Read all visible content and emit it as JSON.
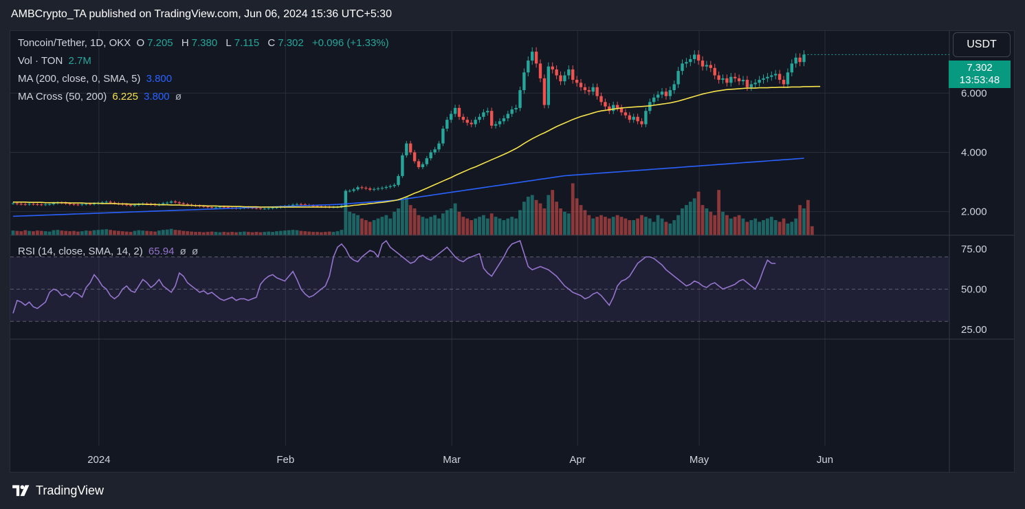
{
  "caption": "AMBCrypto_TA published on TradingView.com, Jun 06, 2024 15:36 UTC+5:30",
  "legend": {
    "symbol": "Toncoin/Tether, 1D, OKX",
    "o_label": "O",
    "o_value": "7.205",
    "h_label": "H",
    "h_value": "7.380",
    "l_label": "L",
    "l_value": "7.115",
    "c_label": "C",
    "c_value": "7.302",
    "change": "+0.096 (+1.33%)",
    "vol_label": "Vol · TON",
    "vol_value": "2.7M",
    "ma_label": "MA (200, close, 0, SMA, 5)",
    "ma_value": "3.800",
    "macross_label": "MA Cross (50, 200)",
    "macross_fast": "6.225",
    "macross_slow": "3.800",
    "macross_symbol": "ø",
    "rsi_label": "RSI (14, close, SMA, 14, 2)",
    "rsi_value": "65.94",
    "rsi_sym1": "ø",
    "rsi_sym2": "ø"
  },
  "currency_button": "USDT",
  "price_tag": {
    "price": "7.302",
    "countdown": "13:53:48"
  },
  "footer_brand": "TradingView",
  "colors": {
    "up": "#26a69a",
    "down": "#ef5350",
    "ma200": "#2962ff",
    "ma50": "#f7e34c",
    "rsi": "#9575cd",
    "background": "#131722",
    "grid": "#2a2e39",
    "text": "#d1d4dc"
  },
  "chart_data": {
    "type": "candlestick",
    "x_ticks": [
      "2024",
      "Feb",
      "Mar",
      "Apr",
      "May",
      "Jun"
    ],
    "price_axis": {
      "ticks": [
        "2.000",
        "4.000",
        "6.000"
      ],
      "range": [
        1.2,
        8.1
      ]
    },
    "rsi_axis": {
      "ticks": [
        "25.00",
        "50.00",
        "75.00"
      ],
      "range": [
        19,
        83
      ],
      "levels": [
        70,
        50,
        30
      ]
    },
    "close": [
      2.28,
      2.26,
      2.25,
      2.24,
      2.26,
      2.25,
      2.24,
      2.23,
      2.24,
      2.25,
      2.28,
      2.3,
      2.29,
      2.27,
      2.25,
      2.24,
      2.23,
      2.25,
      2.26,
      2.25,
      2.27,
      2.29,
      2.31,
      2.33,
      2.3,
      2.28,
      2.26,
      2.24,
      2.22,
      2.2,
      2.22,
      2.25,
      2.27,
      2.26,
      2.24,
      2.22,
      2.25,
      2.28,
      2.3,
      2.34,
      2.31,
      2.28,
      2.25,
      2.23,
      2.21,
      2.2,
      2.18,
      2.17,
      2.15,
      2.13,
      2.14,
      2.16,
      2.15,
      2.13,
      2.12,
      2.11,
      2.12,
      2.14,
      2.13,
      2.12,
      2.11,
      2.1,
      2.1,
      2.11,
      2.13,
      2.14,
      2.16,
      2.18,
      2.2,
      2.23,
      2.25,
      2.24,
      2.22,
      2.2,
      2.19,
      2.18,
      2.17,
      2.16,
      2.15,
      2.15,
      2.16,
      2.2,
      2.7,
      2.7,
      2.75,
      2.82,
      2.8,
      2.78,
      2.74,
      2.76,
      2.78,
      2.8,
      2.83,
      2.86,
      2.9,
      3.2,
      3.9,
      4.3,
      4.0,
      3.7,
      3.5,
      3.6,
      3.8,
      4.0,
      4.1,
      4.3,
      4.8,
      5.1,
      5.3,
      5.5,
      5.2,
      5.1,
      5.0,
      4.95,
      5.1,
      5.2,
      5.35,
      5.4,
      4.9,
      4.95,
      5.05,
      5.15,
      5.3,
      5.45,
      5.5,
      6.1,
      6.7,
      7.1,
      7.4,
      7.0,
      6.5,
      5.6,
      6.9,
      6.8,
      6.6,
      6.4,
      6.6,
      6.8,
      6.45,
      6.35,
      6.2,
      6.1,
      6.05,
      6.2,
      5.9,
      5.7,
      5.55,
      5.4,
      5.6,
      5.5,
      5.35,
      5.25,
      5.1,
      5.2,
      5.05,
      4.95,
      5.4,
      5.7,
      5.85,
      5.95,
      6.05,
      5.9,
      6.1,
      6.3,
      6.75,
      7.0,
      7.05,
      7.15,
      7.3,
      7.1,
      6.9,
      6.95,
      6.85,
      6.6,
      6.45,
      6.5,
      6.35,
      6.55,
      6.5,
      6.4,
      6.45,
      6.2,
      6.3,
      6.35,
      6.45,
      6.5,
      6.55,
      6.6,
      6.65,
      6.45,
      6.3,
      6.7,
      7.0,
      7.2,
      7.05,
      7.302
    ],
    "volume_millions": [
      1.4,
      1.3,
      1.2,
      1.5,
      1.3,
      1.2,
      1.4,
      1.3,
      1.2,
      1.1,
      1.5,
      1.6,
      1.4,
      1.3,
      1.2,
      1.3,
      1.1,
      1.2,
      1.4,
      1.3,
      1.5,
      1.6,
      1.7,
      1.8,
      1.6,
      1.4,
      1.3,
      1.2,
      1.1,
      1.0,
      1.3,
      1.5,
      1.4,
      1.3,
      1.2,
      1.1,
      1.4,
      1.6,
      1.7,
      1.9,
      1.6,
      1.5,
      1.3,
      1.2,
      1.1,
      1.0,
      1.0,
      0.9,
      1.0,
      1.1,
      1.0,
      0.9,
      1.0,
      0.9,
      1.0,
      0.9,
      1.0,
      1.1,
      1.0,
      0.9,
      1.0,
      0.9,
      1.0,
      1.1,
      1.0,
      1.2,
      1.3,
      1.4,
      1.5,
      1.6,
      1.5,
      1.3,
      1.2,
      1.1,
      1.0,
      1.0,
      0.9,
      1.0,
      1.1,
      1.0,
      1.2,
      1.6,
      9.0,
      7.0,
      6.5,
      6.0,
      5.0,
      4.5,
      4.0,
      4.5,
      5.0,
      5.5,
      6.0,
      5.0,
      7.0,
      8.0,
      10.5,
      11.5,
      9.0,
      8.0,
      6.0,
      5.5,
      5.0,
      5.5,
      6.0,
      5.0,
      6.5,
      7.5,
      8.0,
      9.5,
      7.0,
      5.5,
      5.0,
      4.5,
      5.0,
      5.5,
      6.0,
      5.0,
      6.5,
      5.5,
      5.0,
      4.5,
      5.0,
      5.5,
      5.0,
      7.5,
      10.0,
      11.5,
      12.0,
      10.5,
      9.5,
      8.0,
      12.0,
      13.5,
      10.0,
      8.0,
      7.0,
      6.5,
      15.5,
      11.0,
      9.0,
      7.5,
      6.0,
      5.0,
      5.5,
      6.0,
      5.5,
      5.0,
      5.5,
      6.0,
      5.5,
      5.0,
      4.5,
      4.5,
      5.0,
      6.0,
      5.5,
      5.0,
      4.0,
      6.0,
      5.0,
      4.0,
      3.5,
      4.5,
      6.0,
      8.0,
      9.0,
      10.0,
      11.0,
      13.0,
      9.0,
      8.0,
      7.0,
      6.0,
      13.5,
      7.0,
      6.0,
      5.0,
      5.5,
      6.0,
      5.0,
      4.0,
      4.5,
      5.0,
      4.0,
      4.5,
      5.0,
      5.5,
      4.5,
      4.0,
      5.0,
      3.5,
      4.0,
      5.0,
      9.0,
      8.0,
      10.5,
      2.7
    ],
    "ma50": [
      2.32,
      2.32,
      2.32,
      2.32,
      2.31,
      2.31,
      2.31,
      2.31,
      2.3,
      2.3,
      2.3,
      2.3,
      2.3,
      2.3,
      2.29,
      2.29,
      2.29,
      2.29,
      2.28,
      2.28,
      2.28,
      2.28,
      2.27,
      2.27,
      2.27,
      2.27,
      2.26,
      2.26,
      2.26,
      2.25,
      2.25,
      2.25,
      2.25,
      2.24,
      2.24,
      2.24,
      2.23,
      2.23,
      2.23,
      2.22,
      2.22,
      2.22,
      2.21,
      2.21,
      2.21,
      2.2,
      2.2,
      2.2,
      2.19,
      2.19,
      2.19,
      2.18,
      2.18,
      2.18,
      2.17,
      2.17,
      2.17,
      2.16,
      2.16,
      2.16,
      2.16,
      2.15,
      2.15,
      2.15,
      2.15,
      2.15,
      2.15,
      2.15,
      2.15,
      2.15,
      2.15,
      2.15,
      2.15,
      2.15,
      2.15,
      2.15,
      2.15,
      2.15,
      2.15,
      2.15,
      2.15,
      2.16,
      2.18,
      2.19,
      2.21,
      2.22,
      2.24,
      2.25,
      2.27,
      2.28,
      2.3,
      2.31,
      2.33,
      2.35,
      2.37,
      2.4,
      2.45,
      2.5,
      2.56,
      2.62,
      2.67,
      2.73,
      2.79,
      2.85,
      2.91,
      2.97,
      3.03,
      3.09,
      3.15,
      3.22,
      3.28,
      3.34,
      3.4,
      3.46,
      3.51,
      3.57,
      3.63,
      3.69,
      3.75,
      3.81,
      3.87,
      3.93,
      3.99,
      4.06,
      4.13,
      4.21,
      4.3,
      4.38,
      4.46,
      4.53,
      4.6,
      4.66,
      4.73,
      4.8,
      4.87,
      4.93,
      4.99,
      5.05,
      5.11,
      5.16,
      5.21,
      5.25,
      5.29,
      5.33,
      5.37,
      5.4,
      5.42,
      5.44,
      5.46,
      5.48,
      5.5,
      5.51,
      5.52,
      5.53,
      5.54,
      5.55,
      5.56,
      5.57,
      5.59,
      5.61,
      5.63,
      5.65,
      5.67,
      5.7,
      5.73,
      5.77,
      5.81,
      5.85,
      5.89,
      5.93,
      5.97,
      6.0,
      6.03,
      6.06,
      6.08,
      6.1,
      6.12,
      6.13,
      6.14,
      6.15,
      6.16,
      6.17,
      6.17,
      6.17,
      6.18,
      6.18,
      6.18,
      6.19,
      6.19,
      6.2,
      6.2,
      6.2,
      6.21,
      6.21,
      6.21,
      6.22,
      6.22,
      6.223,
      6.224,
      6.225
    ],
    "ma200": [
      1.84,
      1.845,
      1.85,
      1.855,
      1.86,
      1.865,
      1.87,
      1.875,
      1.88,
      1.885,
      1.89,
      1.895,
      1.9,
      1.905,
      1.91,
      1.915,
      1.92,
      1.925,
      1.93,
      1.935,
      1.94,
      1.945,
      1.95,
      1.955,
      1.96,
      1.965,
      1.97,
      1.975,
      1.98,
      1.985,
      1.99,
      1.995,
      2.0,
      2.005,
      2.01,
      2.015,
      2.02,
      2.025,
      2.03,
      2.035,
      2.04,
      2.045,
      2.05,
      2.055,
      2.06,
      2.065,
      2.07,
      2.075,
      2.08,
      2.085,
      2.09,
      2.095,
      2.1,
      2.105,
      2.11,
      2.115,
      2.12,
      2.125,
      2.13,
      2.135,
      2.14,
      2.145,
      2.15,
      2.155,
      2.16,
      2.165,
      2.17,
      2.175,
      2.18,
      2.185,
      2.19,
      2.195,
      2.2,
      2.205,
      2.21,
      2.215,
      2.22,
      2.225,
      2.23,
      2.235,
      2.24,
      2.25,
      2.26,
      2.27,
      2.28,
      2.29,
      2.3,
      2.31,
      2.32,
      2.33,
      2.34,
      2.35,
      2.36,
      2.37,
      2.38,
      2.39,
      2.41,
      2.43,
      2.45,
      2.47,
      2.49,
      2.51,
      2.53,
      2.55,
      2.57,
      2.59,
      2.61,
      2.63,
      2.65,
      2.67,
      2.69,
      2.71,
      2.73,
      2.75,
      2.77,
      2.79,
      2.81,
      2.83,
      2.85,
      2.87,
      2.89,
      2.91,
      2.93,
      2.95,
      2.97,
      2.99,
      3.01,
      3.03,
      3.05,
      3.07,
      3.09,
      3.11,
      3.13,
      3.15,
      3.17,
      3.19,
      3.21,
      3.22,
      3.23,
      3.24,
      3.25,
      3.26,
      3.27,
      3.28,
      3.29,
      3.3,
      3.31,
      3.32,
      3.33,
      3.34,
      3.35,
      3.36,
      3.37,
      3.38,
      3.39,
      3.4,
      3.41,
      3.42,
      3.43,
      3.44,
      3.45,
      3.46,
      3.47,
      3.48,
      3.49,
      3.5,
      3.51,
      3.52,
      3.53,
      3.54,
      3.55,
      3.56,
      3.57,
      3.58,
      3.59,
      3.6,
      3.61,
      3.62,
      3.63,
      3.64,
      3.65,
      3.66,
      3.67,
      3.68,
      3.69,
      3.7,
      3.71,
      3.72,
      3.73,
      3.74,
      3.75,
      3.76,
      3.77,
      3.78,
      3.79,
      3.8
    ],
    "rsi": [
      35,
      43,
      42,
      40,
      42,
      39,
      38,
      40,
      42,
      48,
      50,
      49,
      46,
      47,
      45,
      48,
      47,
      45,
      51,
      54,
      59,
      56,
      52,
      50,
      46,
      44,
      46,
      50,
      52,
      49,
      48,
      52,
      56,
      54,
      51,
      53,
      56,
      52,
      50,
      48,
      52,
      60,
      58,
      54,
      52,
      50,
      48,
      49,
      47,
      48,
      46,
      44,
      43,
      44,
      45,
      43,
      44,
      44,
      43,
      44,
      45,
      53,
      56,
      58,
      59,
      57,
      56,
      55,
      58,
      61,
      56,
      50,
      47,
      45,
      46,
      48,
      50,
      52,
      58,
      70,
      76,
      78,
      75,
      70,
      68,
      67,
      70,
      72,
      74,
      73,
      70,
      78,
      80,
      76,
      74,
      72,
      70,
      68,
      66,
      67,
      70,
      71,
      69,
      68,
      70,
      72,
      74,
      76,
      73,
      70,
      68,
      67,
      69,
      70,
      71,
      72,
      63,
      60,
      58,
      62,
      66,
      70,
      75,
      78,
      79,
      80,
      72,
      64,
      62,
      63,
      64,
      63,
      62,
      60,
      58,
      55,
      52,
      50,
      48,
      47,
      46,
      44,
      45,
      47,
      48,
      46,
      43,
      40,
      45,
      52,
      55,
      56,
      58,
      62,
      66,
      68,
      70,
      70,
      69,
      67,
      65,
      62,
      60,
      58,
      56,
      54,
      52,
      53,
      55,
      54,
      52,
      51,
      53,
      54,
      52,
      50,
      51,
      52,
      53,
      55,
      56,
      54,
      52,
      50,
      55,
      62,
      68,
      66,
      65.94
    ]
  }
}
